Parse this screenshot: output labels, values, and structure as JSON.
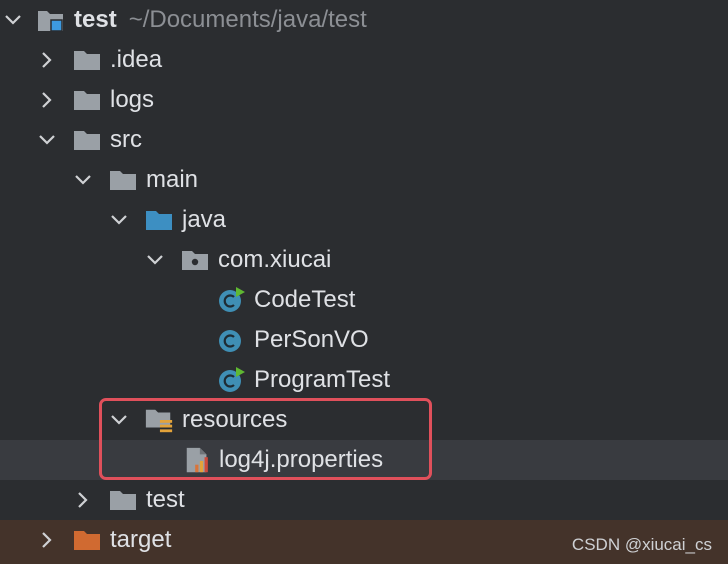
{
  "project": {
    "name": "test",
    "path": "~/Documents/java/test"
  },
  "tree": {
    "idea": ".idea",
    "logs": "logs",
    "src": "src",
    "main": "main",
    "java": "java",
    "package": "com.xiucai",
    "classes": [
      "CodeTest",
      "PerSonVO",
      "ProgramTest"
    ],
    "resources": "resources",
    "properties_file": "log4j.properties",
    "test": "test",
    "target": "target"
  },
  "watermark": "CSDN @xiucai_cs",
  "colors": {
    "background": "#2b2d30",
    "selected_row": "#393b40",
    "excluded_row": "#44332a",
    "highlight_border": "#e0505b",
    "folder": "#9aa0a6",
    "source_folder": "#3d8fc2",
    "excluded_folder": "#d06a31",
    "class_icon": "#3f8fb5",
    "run_marker": "#5fb832"
  }
}
